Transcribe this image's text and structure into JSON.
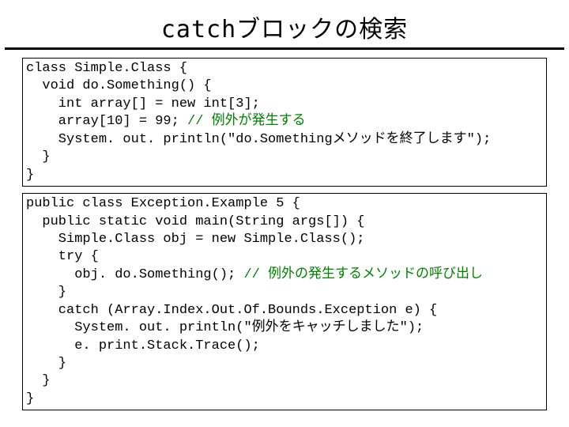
{
  "slide": {
    "title": "catchブロックの検索"
  },
  "code1": {
    "l1": "class Simple.Class {",
    "l2": "  void do.Something() {",
    "l3": "    int array[] = new int[3];",
    "l4a": "    array[10] = 99; ",
    "l4c": "// 例外が発生する",
    "l5": "    System. out. println(\"do.Somethingメソッドを終了します\");",
    "l6": "  }",
    "l7": "}"
  },
  "code2": {
    "l1": "public class Exception.Example 5 {",
    "l2": "  public static void main(String args[]) {",
    "l3": "    Simple.Class obj = new Simple.Class();",
    "l4": "    try {",
    "l5a": "      obj. do.Something(); ",
    "l5c": "// 例外の発生するメソッドの呼び出し",
    "l6": "    }",
    "l7": "    catch (Array.Index.Out.Of.Bounds.Exception e) {",
    "l8": "      System. out. println(\"例外をキャッチしました\");",
    "l9": "      e. print.Stack.Trace();",
    "l10": "    }",
    "l11": "  }",
    "l12": "}"
  }
}
